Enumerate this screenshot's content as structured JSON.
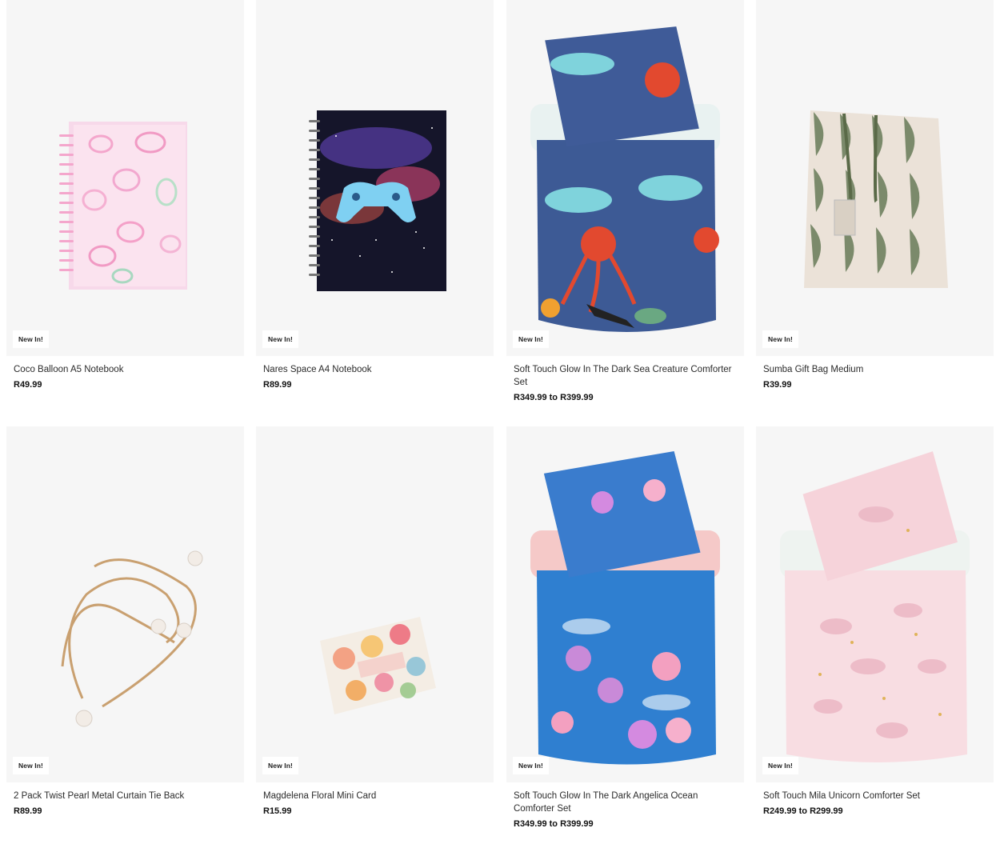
{
  "products": [
    {
      "badge": "New In!",
      "title": "Coco Balloon A5 Notebook",
      "price": "R49.99",
      "image": "pink-balloon-notebook"
    },
    {
      "badge": "New In!",
      "title": "Nares Space A4 Notebook",
      "price": "R89.99",
      "image": "space-gamepad-notebook"
    },
    {
      "badge": "New In!",
      "title": "Soft Touch Glow In The Dark Sea Creature Comforter Set",
      "price": "R349.99 to R399.99",
      "image": "sea-creature-comforter"
    },
    {
      "badge": "New In!",
      "title": "Sumba Gift Bag Medium",
      "price": "R39.99",
      "image": "green-gift-bag"
    },
    {
      "badge": "New In!",
      "title": "2 Pack Twist Pearl Metal Curtain Tie Back",
      "price": "R89.99",
      "image": "pearl-curtain-tie-back"
    },
    {
      "badge": "New In!",
      "title": "Magdelena Floral Mini Card",
      "price": "R15.99",
      "image": "floral-mini-card"
    },
    {
      "badge": "New In!",
      "title": "Soft Touch Glow In The Dark Angelica Ocean Comforter Set",
      "price": "R349.99 to R399.99",
      "image": "ocean-comforter"
    },
    {
      "badge": "New In!",
      "title": "Soft Touch Mila Unicorn Comforter Set",
      "price": "R249.99 to R299.99",
      "image": "unicorn-comforter"
    }
  ]
}
